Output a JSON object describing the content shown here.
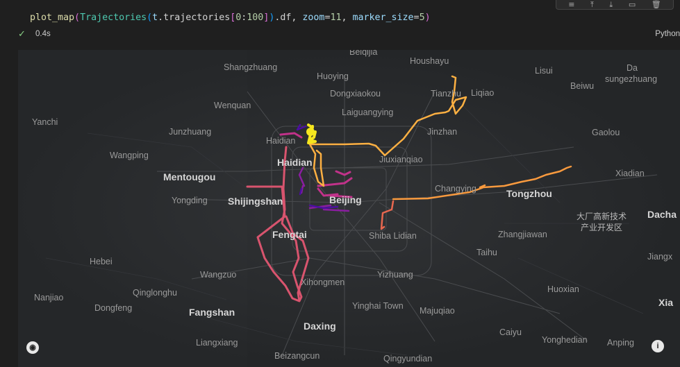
{
  "toolbar": {
    "icons": [
      "run-by-line-icon",
      "execute-above-icon",
      "execute-below-icon",
      "split-cell-icon",
      "delete-icon"
    ]
  },
  "cell": {
    "code_fn": "plot_map",
    "code_cls": "Trajectories",
    "code_var": "t",
    "code_attr1": ".trajectories",
    "code_slice_start": "0",
    "code_slice_end": "100",
    "code_attr2": ".df",
    "code_kw1": "zoom",
    "code_val1": "11",
    "code_kw2": "marker_size",
    "code_val2": "5"
  },
  "status": {
    "duration": "0.4s",
    "kernel": "Python"
  },
  "map": {
    "labels": [
      {
        "text": "Beiqijia",
        "kind": "minor"
      },
      {
        "text": "Houshayu",
        "kind": "minor"
      },
      {
        "text": "Shangzhuang",
        "kind": "minor"
      },
      {
        "text": "Huoying",
        "kind": "minor"
      },
      {
        "text": "Lisui",
        "kind": "minor"
      },
      {
        "text": "Da",
        "kind": "minor"
      },
      {
        "text": "sungezhuang",
        "kind": "minor"
      },
      {
        "text": "Dongxiaokou",
        "kind": "minor"
      },
      {
        "text": "Tianzhu",
        "kind": "minor"
      },
      {
        "text": "Liqiao",
        "kind": "minor"
      },
      {
        "text": "Beiwu",
        "kind": "minor"
      },
      {
        "text": "Wenquan",
        "kind": "minor"
      },
      {
        "text": "Laiguangying",
        "kind": "minor"
      },
      {
        "text": "Yanchi",
        "kind": "minor"
      },
      {
        "text": "Junzhuang",
        "kind": "minor"
      },
      {
        "text": "Haidian",
        "kind": "minor"
      },
      {
        "text": "Jinzhan",
        "kind": "minor"
      },
      {
        "text": "Gaolou",
        "kind": "minor"
      },
      {
        "text": "Wangping",
        "kind": "minor"
      },
      {
        "text": "Haidian",
        "kind": "major"
      },
      {
        "text": "Jiuxianqiao",
        "kind": "minor"
      },
      {
        "text": "Mentougou",
        "kind": "major"
      },
      {
        "text": "Xiadian",
        "kind": "minor"
      },
      {
        "text": "Changying",
        "kind": "minor"
      },
      {
        "text": "Tongzhou",
        "kind": "major"
      },
      {
        "text": "Yongding",
        "kind": "minor"
      },
      {
        "text": "Shijingshan",
        "kind": "major"
      },
      {
        "text": "Beijing",
        "kind": "major"
      },
      {
        "text": "Dacha",
        "kind": "major"
      },
      {
        "text": "大厂高新技术",
        "kind": "cjk"
      },
      {
        "text": "产业开发区",
        "kind": "cjk"
      },
      {
        "text": "Fengtai",
        "kind": "major"
      },
      {
        "text": "Shiba Lidian",
        "kind": "minor"
      },
      {
        "text": "Zhangjiawan",
        "kind": "minor"
      },
      {
        "text": "Taihu",
        "kind": "minor"
      },
      {
        "text": "Hebei",
        "kind": "minor"
      },
      {
        "text": "Jiangx",
        "kind": "minor"
      },
      {
        "text": "Wangzuo",
        "kind": "minor"
      },
      {
        "text": "Yizhuang",
        "kind": "minor"
      },
      {
        "text": "Xihongmen",
        "kind": "minor"
      },
      {
        "text": "Qinglonghu",
        "kind": "minor"
      },
      {
        "text": "Huoxian",
        "kind": "minor"
      },
      {
        "text": "Nanjiao",
        "kind": "minor"
      },
      {
        "text": "Dongfeng",
        "kind": "minor"
      },
      {
        "text": "Yinghai Town",
        "kind": "minor"
      },
      {
        "text": "Majuqiao",
        "kind": "minor"
      },
      {
        "text": "Xia",
        "kind": "major"
      },
      {
        "text": "Fangshan",
        "kind": "major"
      },
      {
        "text": "Daxing",
        "kind": "major"
      },
      {
        "text": "Caiyu",
        "kind": "minor"
      },
      {
        "text": "Liangxiang",
        "kind": "minor"
      },
      {
        "text": "Yonghedian",
        "kind": "minor"
      },
      {
        "text": "Anping",
        "kind": "minor"
      },
      {
        "text": "Beizangcun",
        "kind": "minor"
      },
      {
        "text": "Qingyundian",
        "kind": "minor"
      }
    ],
    "trajectory_colors": {
      "yellow": "#f5e61e",
      "light_orange": "#fdb042",
      "orange": "#f99a3e",
      "salmon": "#e8674f",
      "pink": "#d8546e",
      "magenta": "#c1328a",
      "purple": "#8a1ea0",
      "indigo": "#4c0fa0"
    },
    "controls": {
      "locate_icon": "compass-icon",
      "info_icon": "info-icon"
    }
  }
}
